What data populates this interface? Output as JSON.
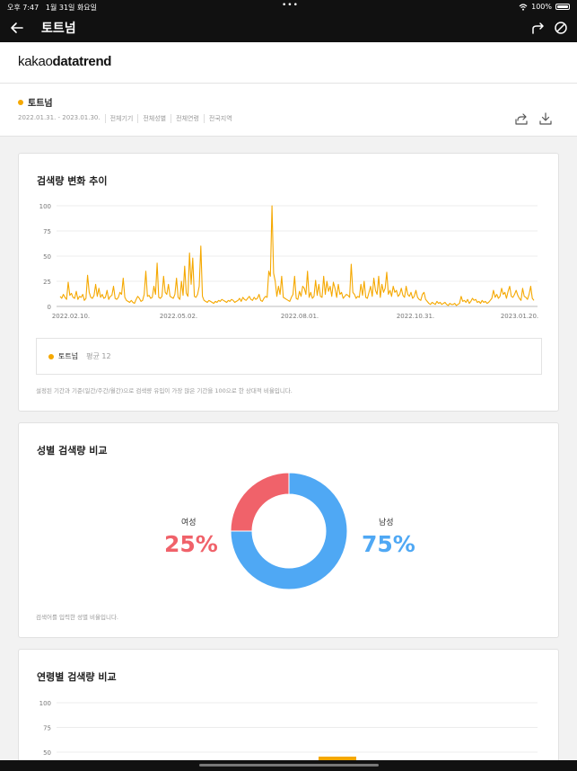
{
  "status_bar": {
    "time": "오후 7:47",
    "date": "1월 31일 화요일",
    "dots": "•••",
    "battery": "100%"
  },
  "nav": {
    "title": "토트넘"
  },
  "brand": {
    "prefix": "kakao",
    "suffix": "datatrend"
  },
  "info": {
    "keyword": "토트넘",
    "date_range": "2022.01.31. - 2023.01.30.",
    "filters": [
      "전체기기",
      "전체성별",
      "전체연령",
      "전국지역"
    ]
  },
  "trend_card": {
    "title": "검색량 변화 추이",
    "legend_name": "토트넘",
    "legend_avg": "평균 12",
    "note": "설정된 기간과 기준(일간/주간/월간)으로 검색량 유입이 가장 많은 기간을 100으로 한 상대적 비율입니다.",
    "chart_data": {
      "type": "line",
      "series": [
        {
          "name": "토트넘",
          "color": "#f5a800"
        }
      ],
      "y_ticks": [
        "100",
        "75",
        "50",
        "25",
        "0"
      ],
      "ylim": [
        0,
        100
      ],
      "x_ticks": [
        "2022.02.10.",
        "2022.05.02.",
        "2022.08.01.",
        "2022.10.31.",
        "2023.01.20."
      ],
      "y_values": [
        10,
        8,
        12,
        9,
        7,
        24,
        11,
        13,
        9,
        8,
        15,
        7,
        10,
        9,
        12,
        6,
        8,
        31,
        14,
        9,
        8,
        11,
        22,
        10,
        18,
        9,
        12,
        8,
        9,
        16,
        7,
        10,
        11,
        20,
        8,
        7,
        9,
        14,
        12,
        28,
        9,
        6,
        5,
        4,
        6,
        4,
        3,
        7,
        10,
        8,
        5,
        6,
        12,
        35,
        10,
        11,
        8,
        9,
        20,
        12,
        43,
        9,
        8,
        10,
        30,
        14,
        12,
        22,
        10,
        9,
        8,
        12,
        28,
        9,
        7,
        25,
        11,
        40,
        13,
        10,
        53,
        22,
        48,
        10,
        9,
        12,
        20,
        60,
        10,
        6,
        5,
        4,
        6,
        5,
        4,
        3,
        5,
        4,
        6,
        5,
        7,
        6,
        5,
        4,
        6,
        5,
        7,
        6,
        4,
        5,
        6,
        8,
        5,
        9,
        7,
        6,
        8,
        10,
        7,
        6,
        9,
        7,
        8,
        12,
        6,
        5,
        8,
        10,
        9,
        35,
        30,
        100,
        33,
        25,
        10,
        20,
        12,
        30,
        9,
        8,
        7,
        6,
        5,
        9,
        12,
        30,
        8,
        7,
        15,
        10,
        20,
        18,
        12,
        35,
        9,
        14,
        8,
        10,
        26,
        11,
        22,
        10,
        9,
        30,
        12,
        25,
        15,
        20,
        10,
        24,
        18,
        9,
        22,
        12,
        14,
        8,
        10,
        12,
        11,
        9,
        42,
        14,
        12,
        8,
        10,
        9,
        22,
        11,
        25,
        9,
        8,
        14,
        20,
        10,
        28,
        16,
        12,
        30,
        9,
        22,
        14,
        18,
        34,
        12,
        16,
        10,
        20,
        14,
        16,
        10,
        12,
        18,
        11,
        9,
        20,
        12,
        10,
        14,
        8,
        10,
        16,
        9,
        7,
        6,
        12,
        14,
        7,
        5,
        3,
        2,
        4,
        3,
        2,
        5,
        3,
        4,
        2,
        3,
        4,
        2,
        1,
        3,
        2,
        2,
        3,
        1,
        2,
        3,
        10,
        5,
        6,
        4,
        7,
        3,
        5,
        8,
        6,
        7,
        4,
        5,
        3,
        6,
        4,
        5,
        3,
        4,
        6,
        8,
        16,
        9,
        12,
        8,
        10,
        18,
        12,
        14,
        8,
        15,
        20,
        10,
        9,
        12,
        16,
        11,
        8,
        6,
        18,
        10,
        9,
        7,
        12,
        20,
        8,
        6
      ]
    }
  },
  "gender_card": {
    "title": "성별 검색량 비교",
    "female_label": "여성",
    "female_value": "25%",
    "male_label": "남성",
    "male_value": "75%",
    "note": "검색어를 입력한 성별 비율입니다.",
    "chart_data": {
      "type": "pie",
      "categories": [
        "여성",
        "남성"
      ],
      "values": [
        25,
        75
      ],
      "colors": [
        "#f0626a",
        "#4fa8f4"
      ]
    }
  },
  "age_card": {
    "title": "연령별 검색량 비교",
    "chart_data": {
      "type": "bar",
      "y_ticks": [
        "100",
        "75",
        "50"
      ],
      "ylim": [
        0,
        100
      ],
      "bar_color": "#f5a800"
    }
  }
}
